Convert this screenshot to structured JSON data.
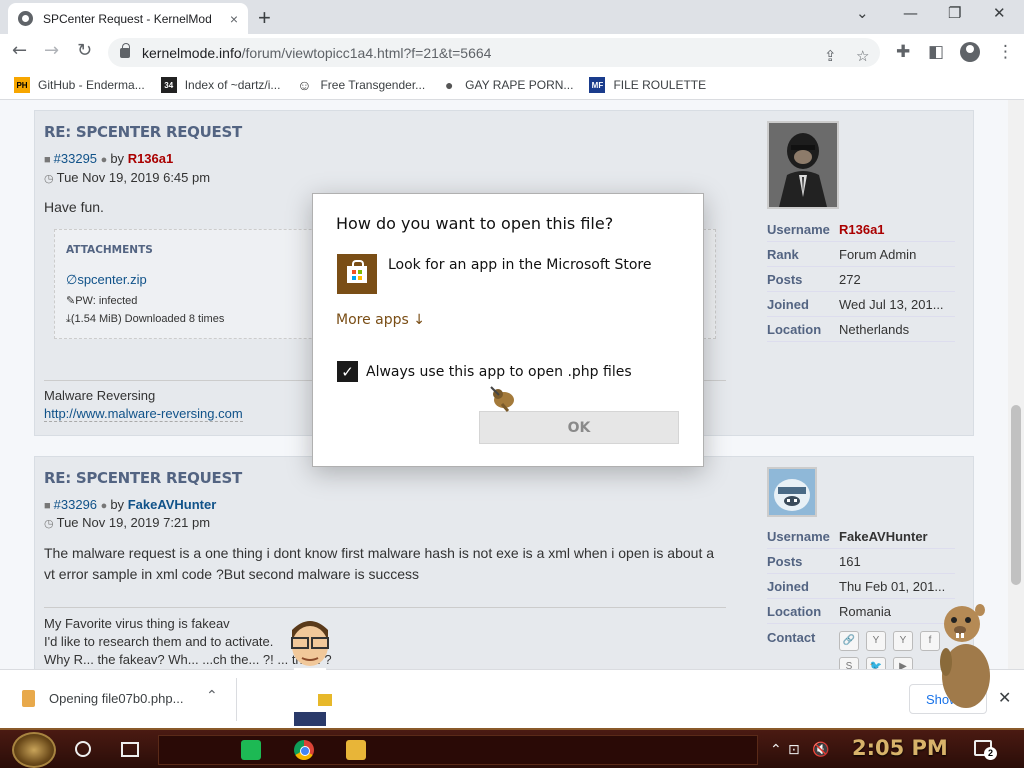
{
  "browser": {
    "tab_title": "SPCenter Request - KernelMod",
    "tab_close": "×",
    "new_tab": "+",
    "url_host": "kernelmode.info",
    "url_path": "/forum/viewtopicc1a4.html?f=21&t=5664",
    "bookmarks": [
      {
        "label": "GitHub - Enderma...",
        "icon": "PH",
        "icon_bg": "#f7a600",
        "icon_fg": "#000"
      },
      {
        "label": "Index of ~dartz/i...",
        "icon": "34",
        "icon_bg": "#222",
        "icon_fg": "#fff"
      },
      {
        "label": "Free Transgender...",
        "icon": "☺",
        "icon_bg": "#fff",
        "icon_fg": "#333"
      },
      {
        "label": "GAY RAPE PORN...",
        "icon": "●",
        "icon_bg": "#fff",
        "icon_fg": "#555"
      },
      {
        "label": "FILE ROULETTE",
        "icon": "MF",
        "icon_bg": "#1a3c8c",
        "icon_fg": "#fff"
      }
    ]
  },
  "posts": [
    {
      "title": "RE: SPCENTER REQUEST",
      "post_id": "#33295",
      "by": "by",
      "author": "R136a1",
      "date": "Tue Nov 19, 2019 6:45 pm",
      "body": "Have fun.",
      "attachments": {
        "heading": "ATTACHMENTS",
        "file": "spcenter.zip",
        "pw": "PW: infected",
        "downloads": "(1.54 MiB) Downloaded 8 times"
      },
      "signature": {
        "line1": "Malware Reversing",
        "link": "http://www.malware-reversing.com"
      },
      "profile": [
        {
          "label": "Username",
          "value": "R136a1"
        },
        {
          "label": "Rank",
          "value": "Forum Admin"
        },
        {
          "label": "Posts",
          "value": "272"
        },
        {
          "label": "Joined",
          "value": "Wed Jul 13, 201..."
        },
        {
          "label": "Location",
          "value": "Netherlands"
        }
      ]
    },
    {
      "title": "RE: SPCENTER REQUEST",
      "post_id": "#33296",
      "by": "by",
      "author": "FakeAVHunter",
      "date": "Tue Nov 19, 2019 7:21 pm",
      "body": "The malware request is a one thing i dont know first malware hash is not exe is a xml when i open is about a vt error sample in xml code ?But second malware is success",
      "signature": {
        "line1": "My Favorite virus thing is fakeav",
        "line2": "I'd like to research them and to activate.",
        "line3": "Why R... the fakeav? Wh... ...ch the... ?! ... the... ?"
      },
      "profile": [
        {
          "label": "Username",
          "value": "FakeAVHunter"
        },
        {
          "label": "Posts",
          "value": "161"
        },
        {
          "label": "Joined",
          "value": "Thu Feb 01, 201..."
        },
        {
          "label": "Location",
          "value": "Romania"
        },
        {
          "label": "Contact",
          "value": ""
        }
      ],
      "contact_icons": [
        "🔗",
        "Y",
        "Y",
        "f",
        "S",
        "🐦",
        "▶"
      ]
    }
  ],
  "dialog": {
    "title": "How do you want to open this file?",
    "store_option": "Look for an app in the Microsoft Store",
    "more_apps": "More apps ↓",
    "always_use": "Always use this app to open .php files",
    "always_checked": true,
    "ok": "OK"
  },
  "downloads": {
    "file": "Opening file07b0.php...",
    "show_all": "Show all"
  },
  "taskbar": {
    "clock": "2:05 PM",
    "notifications": "2"
  }
}
